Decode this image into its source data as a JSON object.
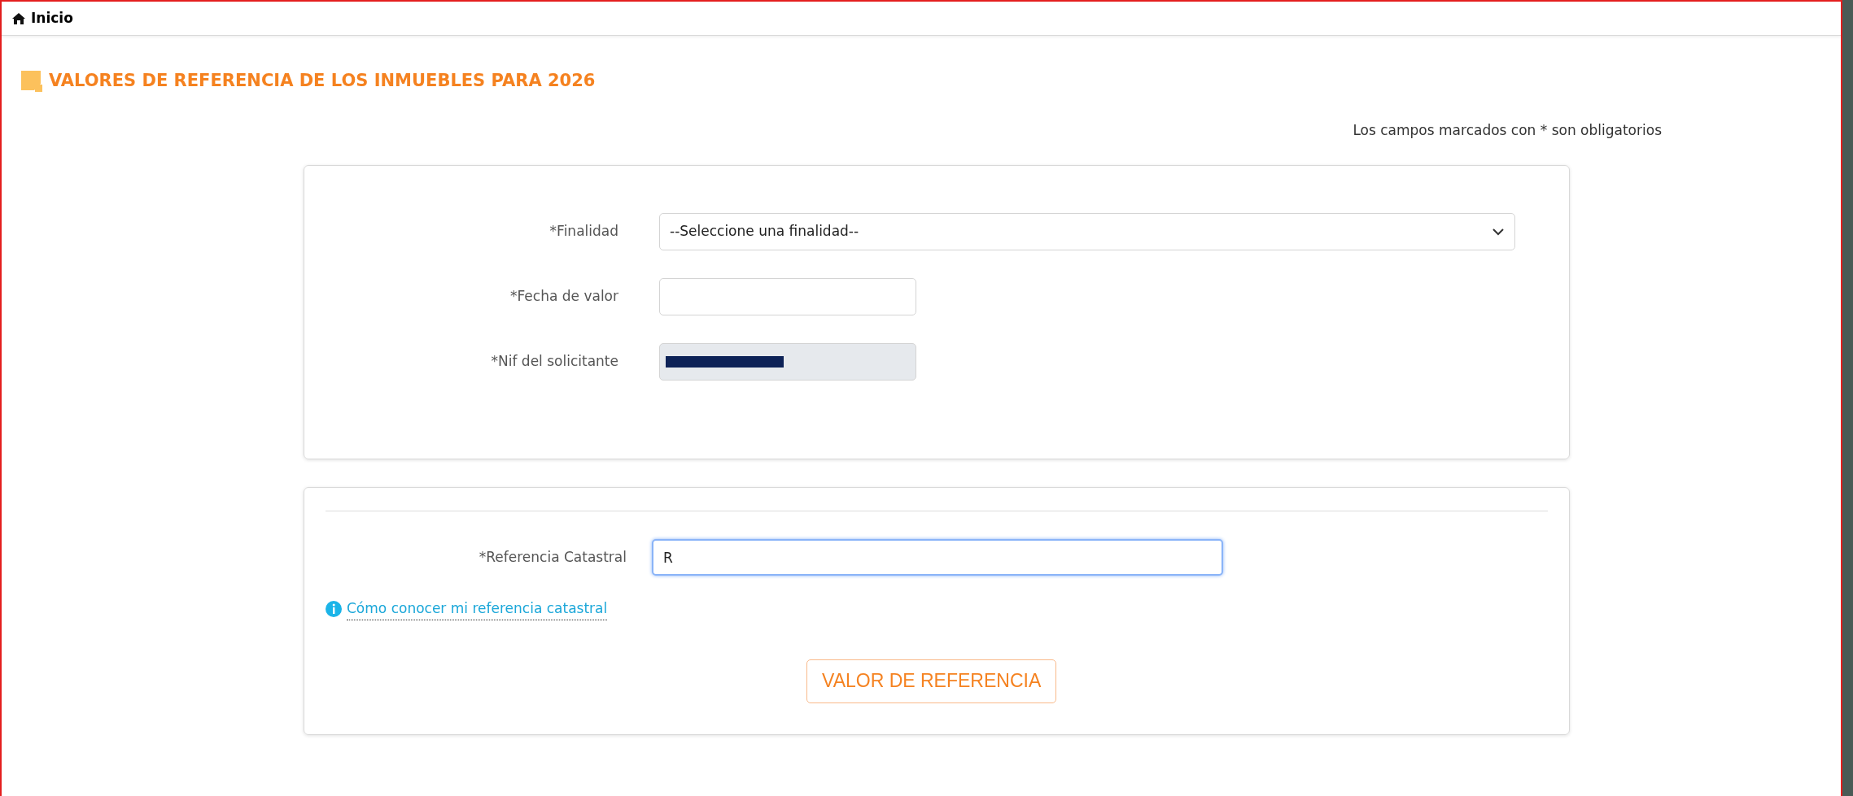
{
  "breadcrumb": {
    "label": "Inicio"
  },
  "title": "VALORES DE REFERENCIA DE LOS INMUEBLES PARA 2026",
  "required_note": "Los campos marcados con * son obligatorios",
  "form": {
    "fields": [
      {
        "kind": "select",
        "label": "*Finalidad",
        "value": "--Seleccione una finalidad--",
        "disabled": false
      },
      {
        "kind": "text",
        "label": "*Fecha de valor",
        "disabled": false
      },
      {
        "kind": "redacted",
        "label": "*Nif del solicitante",
        "disabled": true
      }
    ]
  },
  "reference": {
    "label": "*Referencia Catastral",
    "value": "R",
    "focused": true,
    "help_link": "Cómo conocer mi referencia catastral",
    "button": "VALOR DE REFERENCIA"
  }
}
